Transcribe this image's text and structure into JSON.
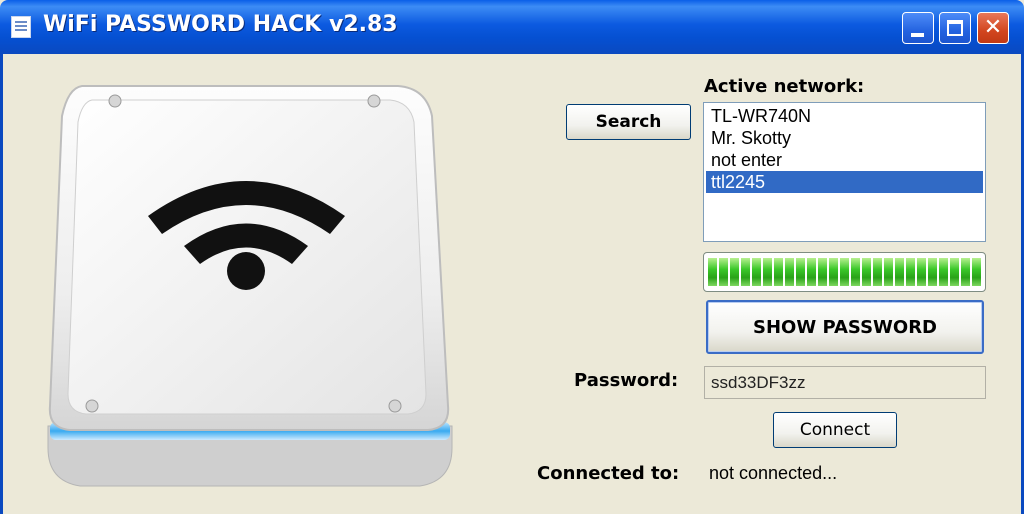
{
  "window": {
    "title": "WiFi PASSWORD HACK v2.83",
    "controls": {
      "minimize": "minimize-icon",
      "maximize": "maximize-icon",
      "close": "close-icon",
      "close_glyph": "✕"
    }
  },
  "networks": {
    "label": "Active network:",
    "items": [
      {
        "name": "TL-WR740N",
        "selected": false
      },
      {
        "name": "Mr. Skotty",
        "selected": false
      },
      {
        "name": "not enter",
        "selected": false
      },
      {
        "name": "ttl2245",
        "selected": true
      }
    ]
  },
  "search_button": "Search",
  "progress": {
    "fraction": 1.0,
    "color": "#3cc82a"
  },
  "show_password_button": "SHOW PASSWORD",
  "password": {
    "label": "Password:",
    "value": "ssd33DF3zz"
  },
  "connect_button": "Connect",
  "connection": {
    "label": "Connected to:",
    "value": "not connected..."
  },
  "colors": {
    "titlebar": "#0a5fe8",
    "selection": "#316ac5",
    "window_bg": "#ece9d8"
  },
  "artwork": {
    "icon": "wifi-router-icon"
  }
}
